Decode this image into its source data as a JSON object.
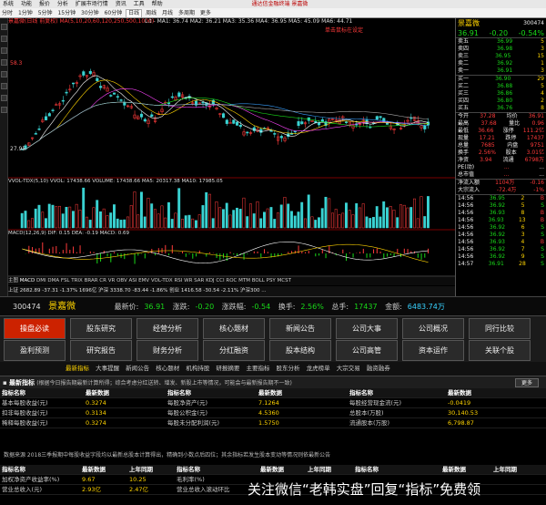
{
  "titlebar": {
    "items": [
      "系统",
      "功能",
      "报价",
      "分析",
      "扩展市场行情",
      "资讯",
      "工具",
      "帮助"
    ],
    "center": "通达信金融终端 景嘉微"
  },
  "toolbar": {
    "items": [
      "分时",
      "1分钟",
      "5分钟",
      "15分钟",
      "30分钟",
      "60分钟",
      "日线",
      "周线",
      "月线",
      "多周期",
      "更多"
    ]
  },
  "chart": {
    "header": "景嘉微(日线 前复权)  MA(5,10,20,60,120,250,500,1000)",
    "ma_values": "L.t - MA1: 36.74  MA2: 36.21  MA3: 35.36  MA4: 36.95  MA5: 45.09  MA6: 44.71",
    "hint": "单击鼠标在设定",
    "price_hi": "58.3",
    "price_lo": "27.95",
    "vol_header": "VVOL-TDX(5,10) VVOL: 17438.66  VOLUME: 17438.66  MA5: 20317.38  MA10: 17985.05",
    "macd_header": "MACD(12,26,9) DIF: 0.15  DEA: -0.19  MACD: 0.69",
    "tabs": [
      "主图",
      "MACD",
      "DMI",
      "DMA",
      "FSL",
      "TRIX",
      "BRAR",
      "CR",
      "VR",
      "OBV",
      "ASI",
      "EMV",
      "VOL-TDX",
      "RSI",
      "WR",
      "SAR",
      "KDJ",
      "CCI",
      "ROC",
      "MTM",
      "BOLL",
      "PSY",
      "MCST"
    ],
    "bottom": "上证 2682.89 -37.31 -1.37%  1696亿  沪深 3338.70 -83.44 -1.86%  创业 1416.58 -30.54 -2.11%  沪深300 ..."
  },
  "quote": {
    "name": "景嘉微",
    "code": "300474",
    "price": "36.91",
    "change": "-0.20",
    "pct": "-0.54%",
    "asks": [
      [
        "卖五",
        "36.99",
        "5"
      ],
      [
        "卖四",
        "36.98",
        "3"
      ],
      [
        "卖三",
        "36.95",
        "15"
      ],
      [
        "卖二",
        "36.92",
        "1"
      ],
      [
        "卖一",
        "36.91",
        "3"
      ]
    ],
    "bids": [
      [
        "买一",
        "36.90",
        "29"
      ],
      [
        "买二",
        "36.88",
        "5"
      ],
      [
        "买三",
        "36.86",
        "4"
      ],
      [
        "买四",
        "36.80",
        "2"
      ],
      [
        "买五",
        "36.76",
        "8"
      ]
    ],
    "stats": [
      [
        "今开",
        "37.28",
        "均价",
        "36.91"
      ],
      [
        "最高",
        "37.68",
        "量比",
        "0.96"
      ],
      [
        "最低",
        "36.66",
        "涨停",
        "111.2亿"
      ],
      [
        "现量",
        "17.21",
        "跌停",
        "17437"
      ],
      [
        "总量",
        "7685",
        "内盘",
        "9751"
      ],
      [
        "换手",
        "2.56%",
        "股本",
        "3.01亿"
      ],
      [
        "净资",
        "3.94",
        "流通",
        "6798万"
      ],
      [
        "PE(动)",
        "...",
        "..."
      ],
      [
        "总市值",
        "...",
        "..."
      ]
    ],
    "flows": [
      [
        "净流入额",
        "1104万",
        "-0.16"
      ],
      [
        "大宗流入",
        "-72.4万",
        "-1%"
      ]
    ],
    "ticks": [
      [
        "14:56",
        "36.95",
        "2",
        "B"
      ],
      [
        "14:56",
        "36.92",
        "5",
        "S"
      ],
      [
        "14:56",
        "36.93",
        "8",
        "B"
      ],
      [
        "14:56",
        "36.93",
        "13",
        "B"
      ],
      [
        "14:56",
        "36.92",
        "6",
        "S"
      ],
      [
        "14:56",
        "36.92",
        "3",
        "S"
      ],
      [
        "14:56",
        "36.93",
        "4",
        "B"
      ],
      [
        "14:56",
        "36.92",
        "7",
        "S"
      ],
      [
        "14:56",
        "36.92",
        "9",
        "S"
      ],
      [
        "14:57",
        "36.91",
        "28",
        "S"
      ]
    ]
  },
  "info": {
    "code": "300474",
    "name": "景嘉微",
    "price_label": "最新价:",
    "price": "36.91",
    "chg_label": "涨跌:",
    "chg": "-0.20",
    "amp_label": "涨跌幅:",
    "amp": "-0.54",
    "turn_label": "换手:",
    "turn": "2.56%",
    "vol_label": "总手:",
    "vol": "17437",
    "amt_label": "金额:",
    "amt": "6483.74万"
  },
  "nav": {
    "row1": [
      "操盘必读",
      "股东研究",
      "经营分析",
      "核心题材",
      "新闻公告",
      "公司大事",
      "公司概况",
      "同行比较"
    ],
    "row2": [
      "盈利预测",
      "研究报告",
      "财务分析",
      "分红融资",
      "股本结构",
      "公司高管",
      "资本运作",
      "关联个股"
    ]
  },
  "subnav": [
    "最新指标",
    "大事提醒",
    "新闻公告",
    "核心题材",
    "机构持股",
    "研报摘要",
    "主要指标",
    "股东分析",
    "龙虎榜单",
    "大宗交易",
    "融资融券"
  ],
  "section": {
    "title": "最新指标",
    "desc": "(根据今日报告期最新计算所得；综合考虑分红送转、增发、新股上市等情况，可能会与最新报告期不一致)",
    "more": "更多"
  },
  "fin": {
    "headers": [
      "指标名称",
      "最新数据",
      "指标名称",
      "最新数据",
      "指标名称",
      "最新数据"
    ],
    "rows": [
      [
        "基本每股收益(元)",
        "0.3274",
        "每股净资产(元)",
        "7.1264",
        "每股经营现金流(元)",
        "-0.0419"
      ],
      [
        "扣非每股收益(元)",
        "0.3134",
        "每股公积金(元)",
        "4.5360",
        "总股本(万股)",
        "30,140.53"
      ],
      [
        "稀释每股收益(元)",
        "0.3274",
        "每股未分配利润(元)",
        "1.5750",
        "流通股本(万股)",
        "6,798.87"
      ]
    ],
    "note": "数据来源 2018三季报期中每股收益字段均以最新总股本计算得出，精确到小数点后四位；其余指标若发生股本变动等情况则依最新公告",
    "headers2": [
      "指标名称",
      "最新数据",
      "上年同期",
      "指标名称",
      "最新数据",
      "上年同期",
      "指标名称",
      "最新数据",
      "上年同期"
    ],
    "rows2": [
      [
        "加权净资产收益率(%)",
        "9.67",
        "10.25",
        "毛利率(%)",
        "",
        "",
        "",
        "",
        ""
      ],
      [
        "营业总收入(元)",
        "2.93亿",
        "2.47亿",
        "营业总收入滚动环比",
        "",
        "",
        "",
        "",
        ""
      ]
    ]
  },
  "watermark": "关注微信“老韩实盘”回复“指标”免费领"
}
